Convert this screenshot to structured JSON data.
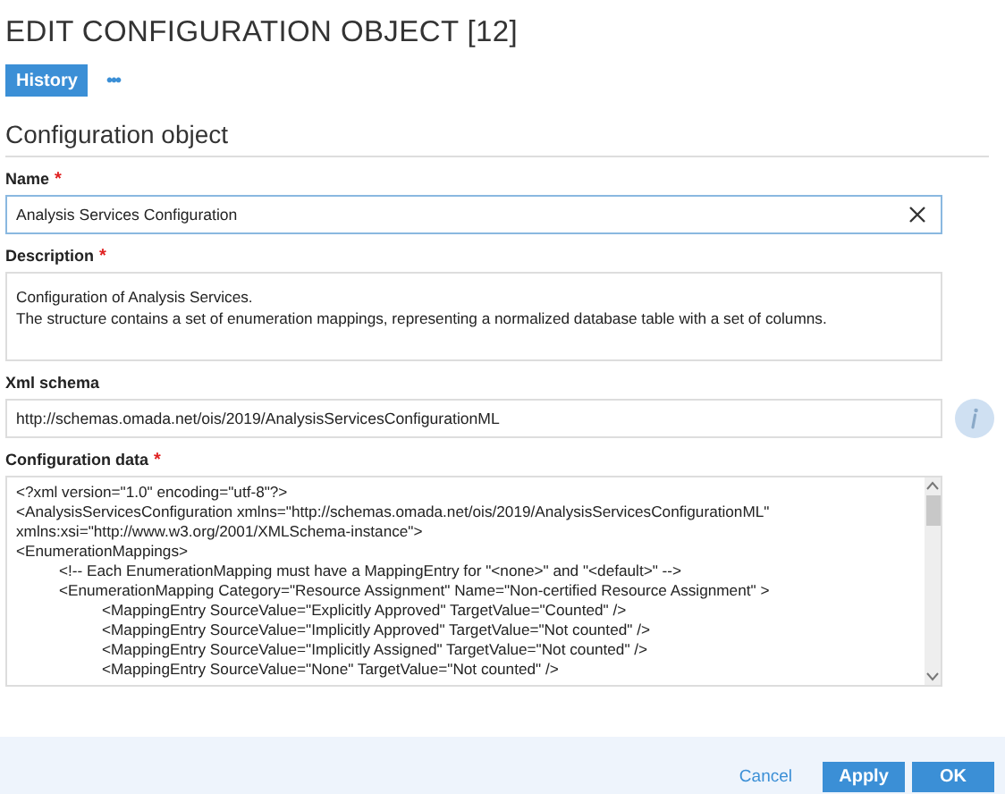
{
  "title": "EDIT CONFIGURATION OBJECT [12]",
  "toolbar": {
    "history_button": "History",
    "more_button": "•••"
  },
  "section_title": "Configuration object",
  "fields": [
    {
      "label": "Name",
      "required_mark": "*",
      "kind": "input",
      "value": "Analysis Services Configuration",
      "clearable": true,
      "info": false
    },
    {
      "label": "Description",
      "required_mark": "*",
      "kind": "textarea",
      "lines": [
        "Configuration of Analysis Services.",
        "The structure contains a set of enumeration mappings, representing a normalized database table with a set of columns."
      ]
    },
    {
      "label": "Xml schema",
      "kind": "input",
      "value": "http://schemas.omada.net/ois/2019/AnalysisServicesConfigurationML",
      "clearable": false,
      "info": true
    },
    {
      "label": "Configuration data",
      "required_mark": "*",
      "kind": "code",
      "lines": [
        {
          "text": "<?xml version=\"1.0\" encoding=\"utf-8\"?>"
        },
        {
          "text": "<AnalysisServicesConfiguration xmlns=\"http://schemas.omada.net/ois/2019/AnalysisServicesConfigurationML\""
        },
        {
          "text": "xmlns:xsi=\"http://www.w3.org/2001/XMLSchema-instance\">"
        },
        {
          "text": "<EnumerationMappings>",
          "children": [
            {
              "text": "<!-- Each EnumerationMapping must have a MappingEntry for \"<none>\" and \"<default>\" -->"
            },
            {
              "text": "<EnumerationMapping Category=\"Resource Assignment\" Name=\"Non-certified Resource Assignment\" >",
              "children": [
                {
                  "text": "<MappingEntry SourceValue=\"Explicitly Approved\" TargetValue=\"Counted\" />"
                },
                {
                  "text": "<MappingEntry SourceValue=\"Implicitly Approved\" TargetValue=\"Not counted\" />"
                },
                {
                  "text": "<MappingEntry SourceValue=\"Implicitly Assigned\" TargetValue=\"Not counted\" />"
                },
                {
                  "text": "<MappingEntry SourceValue=\"None\" TargetValue=\"Not counted\" />"
                }
              ]
            }
          ]
        }
      ]
    }
  ],
  "footer": {
    "cancel": "Cancel",
    "apply": "Apply",
    "ok": "OK"
  }
}
